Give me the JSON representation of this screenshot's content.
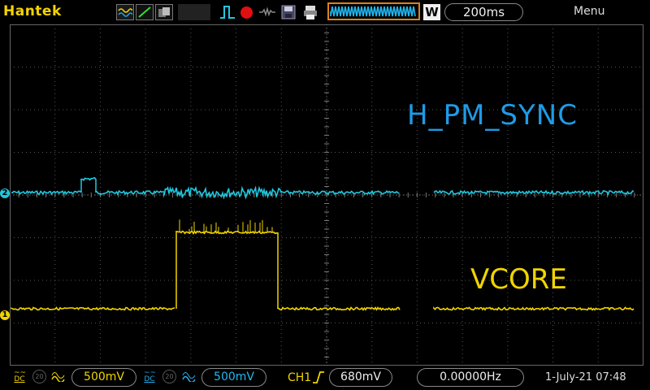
{
  "header": {
    "brand": "Hantek",
    "timebase": "200ms",
    "memory_depth_badge": "W",
    "menu_label": "Menu"
  },
  "traces": {
    "ch2_label": "H_PM_SYNC",
    "ch1_label": "VCORE",
    "ch2_marker": "2",
    "ch1_marker": "1"
  },
  "footer": {
    "ch1_coupling": "DC",
    "ch1_bw": "20",
    "ch1_scale": "500mV",
    "ch2_coupling": "DC",
    "ch2_bw": "20",
    "ch2_scale": "500mV",
    "trigger_source": "CH1",
    "trigger_level": "680mV",
    "frequency": "0.00000Hz",
    "datetime": "1-July-21 07:48"
  },
  "colors": {
    "ch1": "#f0d400",
    "ch2": "#20c8e0",
    "brand": "#f5d300",
    "run": "#e01010",
    "memory_box": "#e08020"
  },
  "icons": [
    "waveform-icon",
    "line-icon",
    "persist-icon",
    "trigger-pulse-icon",
    "run-stop-dot-icon",
    "stop-icon",
    "save-icon",
    "print-icon",
    "edge-rising-icon"
  ]
}
